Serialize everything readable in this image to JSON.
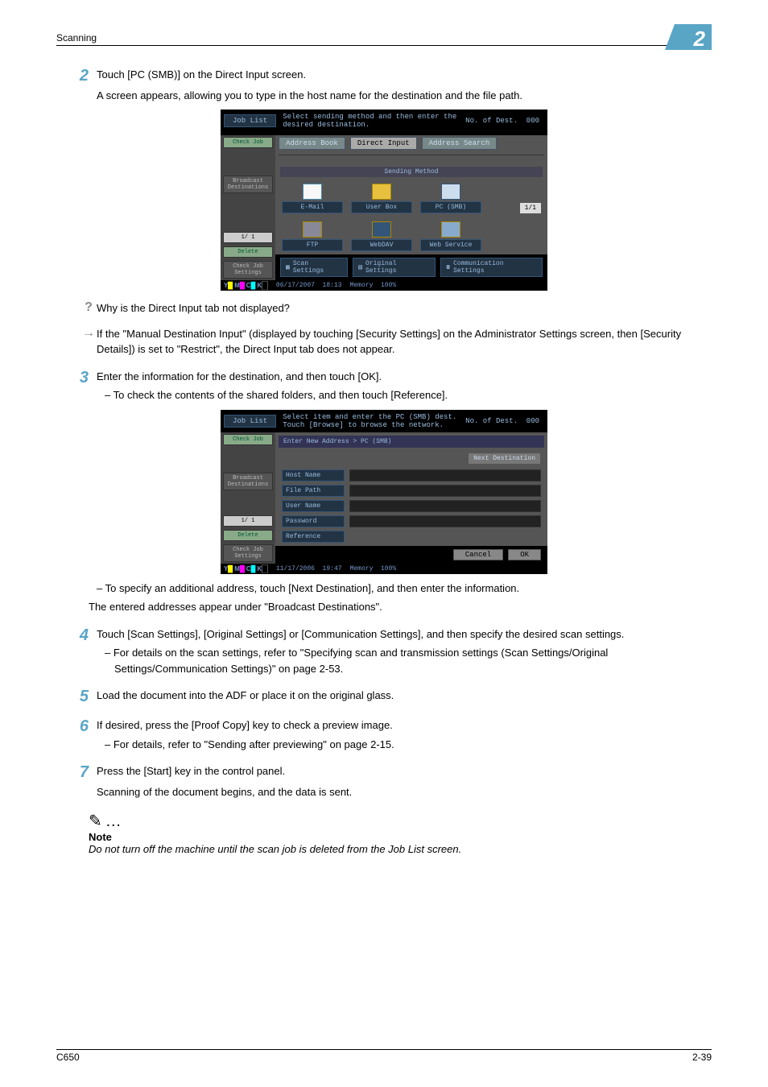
{
  "header": {
    "section": "Scanning",
    "chapter_num": "2"
  },
  "footer": {
    "model": "C650",
    "pg": "2-39"
  },
  "step2": {
    "num": "2",
    "line1": "Touch [PC (SMB)] on the Direct Input screen.",
    "line2": "A screen appears, allowing you to type in the host name for the destination and the file path."
  },
  "qa": {
    "q": "Why is the Direct Input tab not displayed?",
    "a": "If the \"Manual Destination Input\" (displayed by touching [Security Settings] on the Administrator Settings screen, then [Security Details]) is set to \"Restrict\", the Direct Input tab does not appear."
  },
  "step3": {
    "num": "3",
    "line1": "Enter the information for the destination, and then touch [OK].",
    "sub1": "To check the contents of the shared folders, and then touch [Reference].",
    "post1": "To specify an additional address, touch [Next Destination], and then enter the information.",
    "post2": "The entered addresses appear under \"Broadcast Destinations\"."
  },
  "step4": {
    "num": "4",
    "line1": "Touch [Scan Settings], [Original Settings] or [Communication Settings], and then specify the desired scan settings.",
    "sub1": "For details on the scan settings, refer to \"Specifying scan and transmission settings (Scan Settings/Original Settings/Communication Settings)\" on page 2-53."
  },
  "step5": {
    "num": "5",
    "line1": "Load the document into the ADF or place it on the original glass."
  },
  "step6": {
    "num": "6",
    "line1": "If desired, press the [Proof Copy] key to check a preview image.",
    "sub1": "For details, refer to \"Sending after previewing\" on page 2-15."
  },
  "step7": {
    "num": "7",
    "line1": "Press the [Start] key in the control panel.",
    "line2": "Scanning of the document begins, and the data is sent."
  },
  "note": {
    "head": "Note",
    "body": "Do not turn off the machine until the scan job is deleted from the Job List screen."
  },
  "shot1": {
    "job_list": "Job List",
    "msg": "Select sending method and then enter the desired destination.",
    "dest_lbl": "No. of Dest.",
    "dest_val": "000",
    "check_job": "Check Job",
    "tab_addr": "Address Book",
    "tab_direct": "Direct Input",
    "tab_search": "Address Search",
    "broadcast": "Broadcast Destinations",
    "pager_sb": "1/  1",
    "delete": "Delete",
    "chk_set": "Check Job Settings",
    "meth_head": "Sending Method",
    "tiles": {
      "email": "E-Mail",
      "ubox": "User Box",
      "pcsmb": "PC (SMB)",
      "ftp": "FTP",
      "webdav": "WebDAV",
      "ws": "Web Service"
    },
    "pg_ind": "1/1",
    "bb": {
      "scan": "Scan Settings",
      "orig": "Original Settings",
      "comm": "Communication Settings"
    },
    "status_date": "06/17/2007",
    "status_time": "18:13",
    "status_mem": "Memory",
    "status_pct": "100%"
  },
  "shot2": {
    "job_list": "Job List",
    "msg": "Select item and enter the PC (SMB) dest. Touch [Browse] to browse the network.",
    "dest_lbl": "No. of Dest.",
    "dest_val": "000",
    "check_job": "Check Job",
    "breadcrumb": "Enter New Address > PC (SMB)",
    "broadcast": "Broadcast Destinations",
    "next_dest": "Next Destination",
    "fields": {
      "host": "Host Name",
      "path": "File Path",
      "user": "User Name",
      "pass": "Password",
      "ref": "Reference"
    },
    "pager_sb": "1/  1",
    "delete": "Delete",
    "chk_set": "Check Job Settings",
    "cancel": "Cancel",
    "ok": "OK",
    "status_date": "11/17/2006",
    "status_time": "19:47",
    "status_mem": "Memory",
    "status_pct": "100%"
  }
}
